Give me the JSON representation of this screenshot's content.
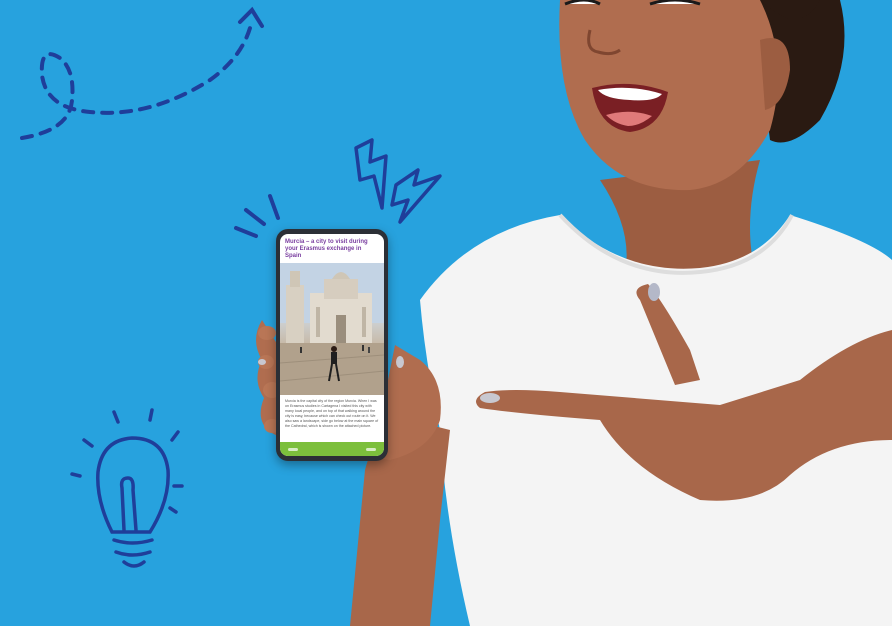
{
  "colors": {
    "background": "#27a2de",
    "doodle": "#1f3e9a",
    "shirt": "#f4f4f4",
    "skin": "#a8674a",
    "accent_title": "#7a3fa0",
    "nav_bar": "#7cbf3c"
  },
  "doodles": {
    "icons": [
      "dashed-arrow-icon",
      "lightning-bolt-icon",
      "sparkle-lines-icon",
      "lightbulb-icon"
    ]
  },
  "phone": {
    "article_title": "Murcia – a city to visit during your Erasmus exchange in Spain",
    "article_body": "Murcia is the capital city of the region Murcia. When I was on Erasmus studies in Cartagena I visited this city with many local people, and on top of that walking around the city is easy, because which can check out route on it. We also saw a landscape, side go below at the main square of the Cathedral, which is shown on the attached picture."
  }
}
